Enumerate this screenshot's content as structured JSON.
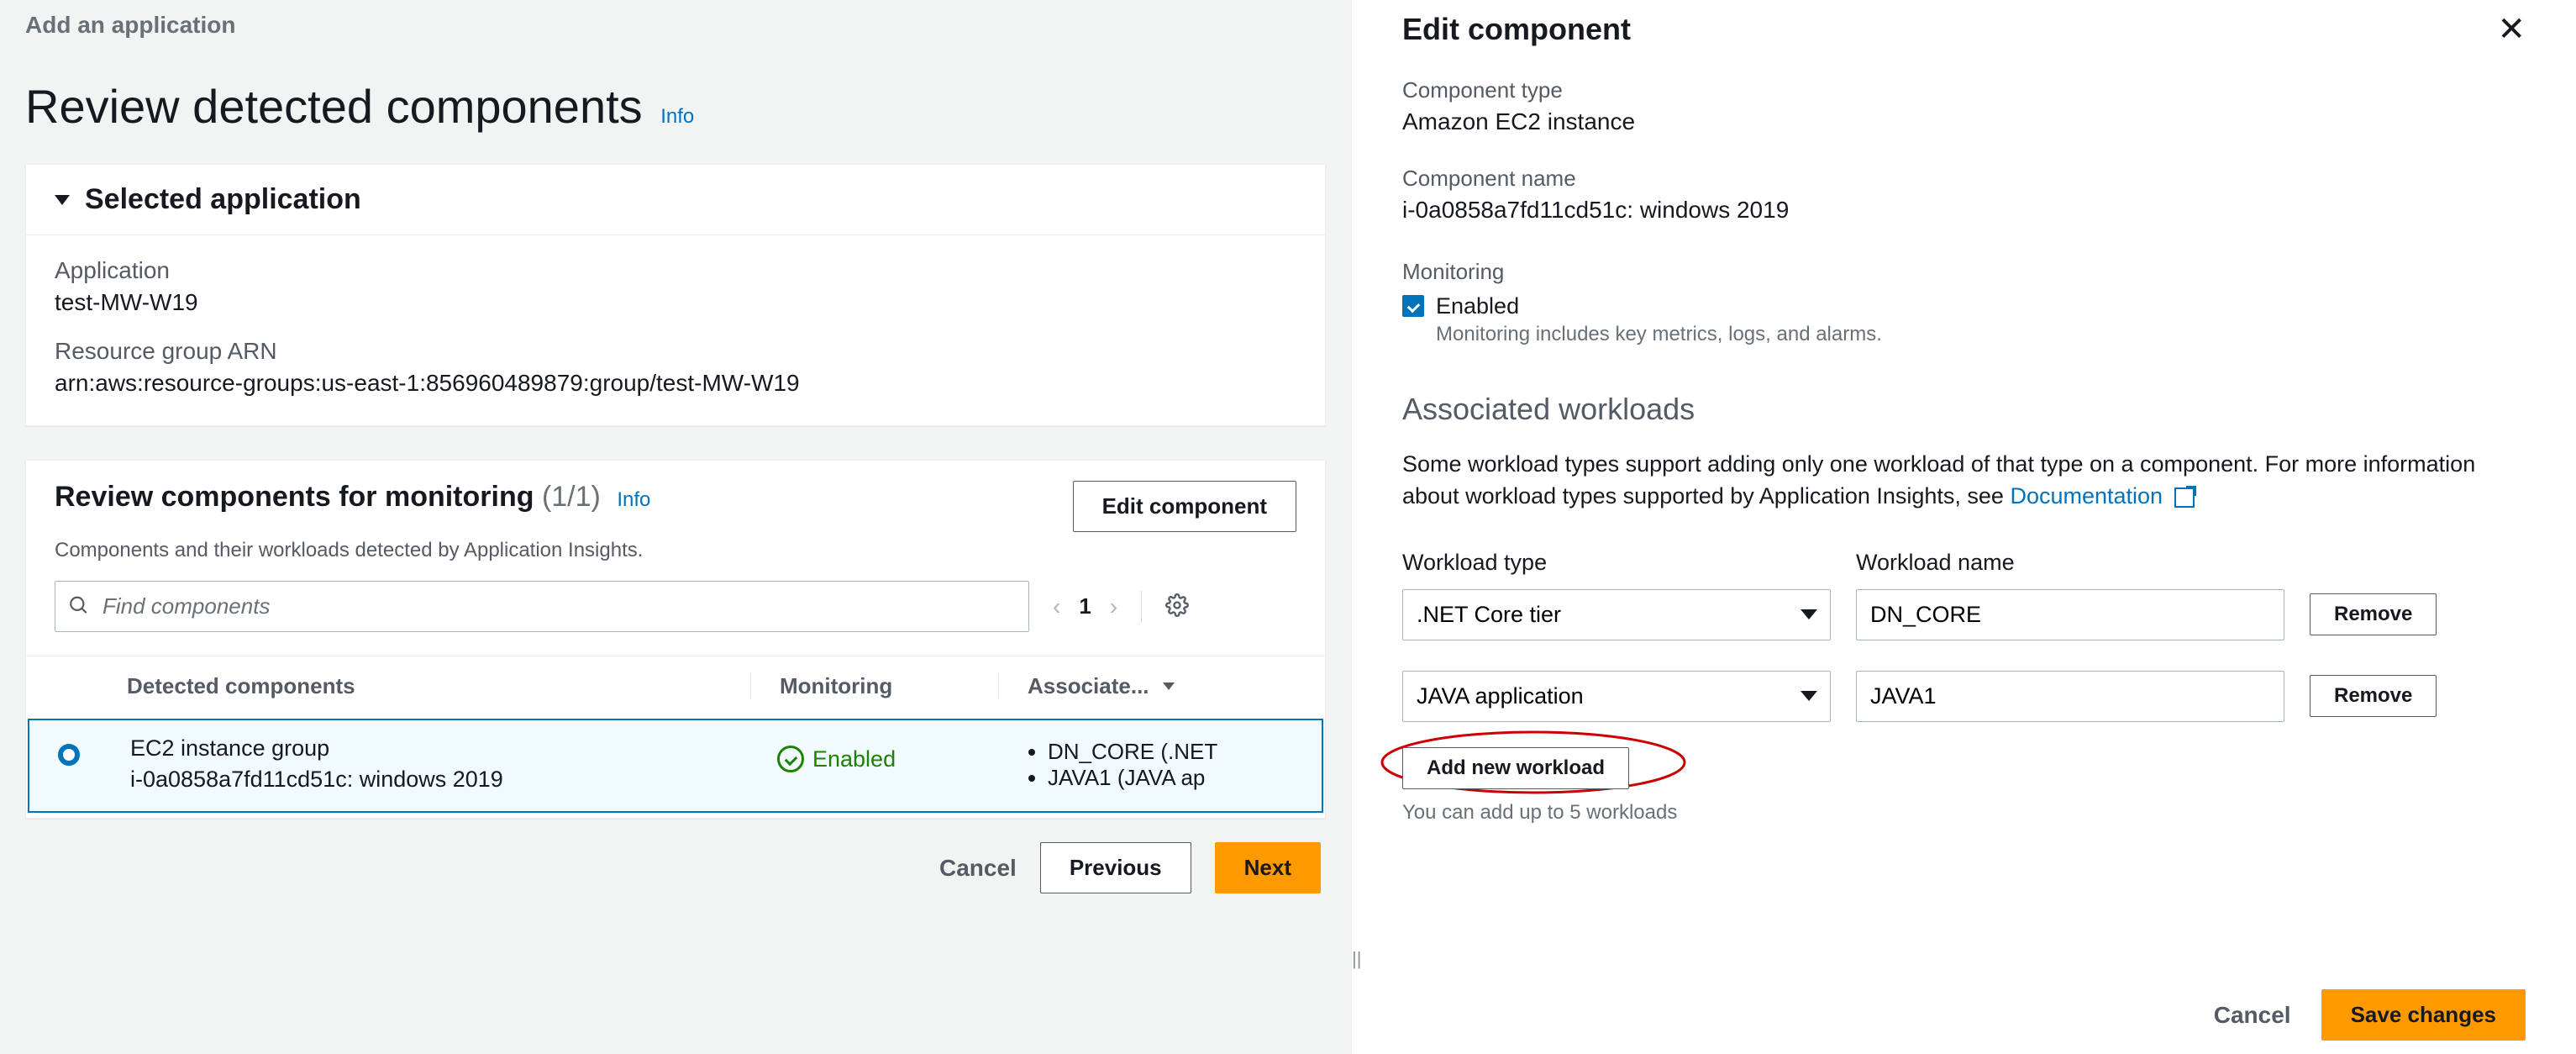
{
  "breadcrumb": "Add an application",
  "page_title": "Review detected components",
  "info_label": "Info",
  "selected_app_panel": {
    "title": "Selected application",
    "application_label": "Application",
    "application_value": "test-MW-W19",
    "arn_label": "Resource group ARN",
    "arn_value": "arn:aws:resource-groups:us-east-1:856960489879:group/test-MW-W19"
  },
  "components_panel": {
    "title": "Review components for monitoring",
    "counter": "(1/1)",
    "info": "Info",
    "subtitle": "Components and their workloads detected by Application Insights.",
    "edit_button": "Edit component",
    "search_placeholder": "Find components",
    "page_number": "1",
    "columns": {
      "detected": "Detected components",
      "monitoring": "Monitoring",
      "associated": "Associate..."
    },
    "row": {
      "name": "EC2 instance group",
      "id": "i-0a0858a7fd11cd51c: windows 2019",
      "monitoring": "Enabled",
      "workloads": [
        "DN_CORE (.NET",
        "JAVA1 (JAVA ap"
      ]
    }
  },
  "footer": {
    "cancel": "Cancel",
    "previous": "Previous",
    "next": "Next"
  },
  "right": {
    "title": "Edit component",
    "component_type_label": "Component type",
    "component_type_value": "Amazon EC2 instance",
    "component_name_label": "Component name",
    "component_name_value": "i-0a0858a7fd11cd51c: windows 2019",
    "monitoring_label": "Monitoring",
    "monitoring_checkbox_label": "Enabled",
    "monitoring_hint": "Monitoring includes key metrics, logs, and alarms.",
    "assoc_heading": "Associated workloads",
    "assoc_desc_pre": "Some workload types support adding only one workload of that type on a component. For more information about workload types supported by Application Insights, see ",
    "assoc_desc_link": "Documentation",
    "wl_type_label": "Workload type",
    "wl_name_label": "Workload name",
    "remove_label": "Remove",
    "workloads": [
      {
        "type": ".NET Core tier",
        "name": "DN_CORE"
      },
      {
        "type": "JAVA application",
        "name": "JAVA1"
      }
    ],
    "add_button": "Add new workload",
    "add_hint": "You can add up to 5 workloads",
    "cancel": "Cancel",
    "save": "Save changes"
  }
}
